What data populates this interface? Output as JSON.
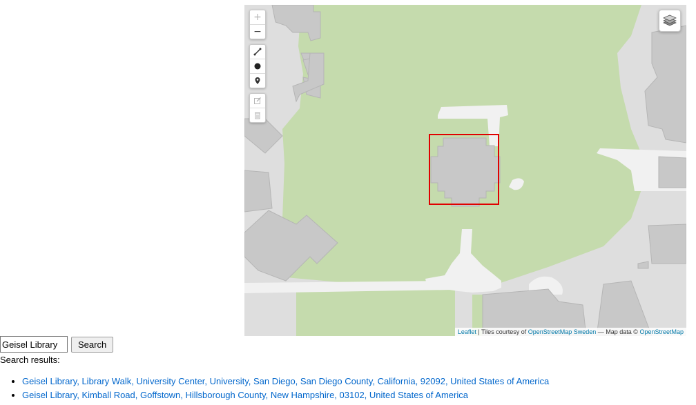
{
  "map": {
    "zoom_in_label": "+",
    "zoom_out_label": "−",
    "draw_tools": [
      "polyline-icon",
      "circle-icon",
      "marker-icon"
    ],
    "edit_tools": [
      "edit-icon",
      "trash-icon"
    ],
    "layers_icon": "layers-icon",
    "highlight_color": "#e00000",
    "park_color": "#c5dbad",
    "building_color": "#c8c8c8",
    "attribution": {
      "leaflet": "Leaflet",
      "separator": " | Tiles courtesy of ",
      "tiles_link": "OpenStreetMap Sweden",
      "middle": " — Map data © ",
      "data_link": "OpenStreetMap"
    }
  },
  "search": {
    "input_value": "Geisel Library",
    "button_label": "Search",
    "results_label": "Search results:",
    "results": [
      "Geisel Library, Library Walk, University Center, University, San Diego, San Diego County, California, 92092, United States of America",
      "Geisel Library, Kimball Road, Goffstown, Hillsborough County, New Hampshire, 03102, United States of America"
    ]
  }
}
